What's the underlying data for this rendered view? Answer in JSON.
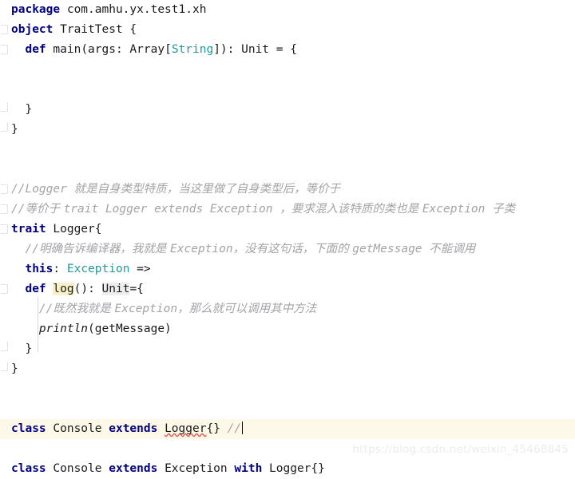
{
  "app": {
    "kind": "code-editor",
    "language": "Scala",
    "background": "#ffffff",
    "current_line_background": "#fdf8e8",
    "colors": {
      "keyword": "#000080",
      "type": "#20999d",
      "comment": "#a3a3a8",
      "identifier_highlight": "#faf0c8",
      "soft_highlight": "#eeeeee",
      "error_squiggle": "#e05a4f",
      "text": "#1a1a1a"
    }
  },
  "watermark": {
    "text": "https://blog.csdn.net/weixin_45468845"
  },
  "code": {
    "lines": [
      {
        "id": 1,
        "fold": "none",
        "tokens": [
          {
            "t": "package",
            "c": "kw"
          },
          {
            "t": " com.amhu.yx.test1.xh",
            "c": "plain"
          }
        ]
      },
      {
        "id": 2,
        "fold": "start",
        "tokens": [
          {
            "t": "object",
            "c": "kw"
          },
          {
            "t": " TraitTest {",
            "c": "plain"
          }
        ]
      },
      {
        "id": 3,
        "fold": "start",
        "indent": 1,
        "tokens": [
          {
            "t": "  ",
            "c": "plain"
          },
          {
            "t": "def",
            "c": "kw"
          },
          {
            "t": " main(args: Array[",
            "c": "plain"
          },
          {
            "t": "String",
            "c": "type"
          },
          {
            "t": "]): Unit = {",
            "c": "plain"
          }
        ]
      },
      {
        "id": 4,
        "fold": "none",
        "tokens": []
      },
      {
        "id": 5,
        "fold": "none",
        "tokens": []
      },
      {
        "id": 6,
        "fold": "end",
        "tokens": [
          {
            "t": "  }",
            "c": "plain"
          }
        ]
      },
      {
        "id": 7,
        "fold": "end",
        "tokens": [
          {
            "t": "}",
            "c": "plain"
          }
        ]
      },
      {
        "id": 8,
        "fold": "none",
        "tokens": []
      },
      {
        "id": 9,
        "fold": "none",
        "tokens": []
      },
      {
        "id": 10,
        "fold": "start",
        "tokens": [
          {
            "t": "//Logger ",
            "c": "cmt-mono"
          },
          {
            "t": "就是自身类型特质，当这里做了自身类型后，等价于",
            "c": "cmt"
          }
        ]
      },
      {
        "id": 11,
        "fold": "start",
        "tokens": [
          {
            "t": "//",
            "c": "cmt-mono"
          },
          {
            "t": "等价于 ",
            "c": "cmt"
          },
          {
            "t": "trait Logger extends Exception ",
            "c": "cmt-mono"
          },
          {
            "t": "，要求混入该特质的类也是 ",
            "c": "cmt"
          },
          {
            "t": "Exception ",
            "c": "cmt-mono"
          },
          {
            "t": "子类",
            "c": "cmt"
          }
        ]
      },
      {
        "id": 12,
        "fold": "start",
        "tokens": [
          {
            "t": "trait",
            "c": "kw"
          },
          {
            "t": " Logger{",
            "c": "plain"
          }
        ]
      },
      {
        "id": 13,
        "fold": "none",
        "tokens": [
          {
            "t": "  ",
            "c": "plain"
          },
          {
            "t": "//",
            "c": "cmt-mono"
          },
          {
            "t": "明确告诉编译器，我就是 ",
            "c": "cmt"
          },
          {
            "t": "Exception",
            "c": "cmt-mono"
          },
          {
            "t": "，没有这句话，下面的 ",
            "c": "cmt"
          },
          {
            "t": "getMessage ",
            "c": "cmt-mono"
          },
          {
            "t": "不能调用",
            "c": "cmt"
          }
        ]
      },
      {
        "id": 14,
        "fold": "none",
        "tokens": [
          {
            "t": "  ",
            "c": "plain"
          },
          {
            "t": "this",
            "c": "kw"
          },
          {
            "t": ": ",
            "c": "plain"
          },
          {
            "t": "Exception",
            "c": "type"
          },
          {
            "t": " =>",
            "c": "plain"
          }
        ]
      },
      {
        "id": 15,
        "fold": "start",
        "indent": 1,
        "tokens": [
          {
            "t": "  ",
            "c": "plain"
          },
          {
            "t": "def",
            "c": "kw"
          },
          {
            "t": " ",
            "c": "plain"
          },
          {
            "t": "log",
            "c": "hl-ident"
          },
          {
            "t": "(): ",
            "c": "plain"
          },
          {
            "t": "Unit",
            "c": "hl-soft"
          },
          {
            "t": "={",
            "c": "plain"
          }
        ]
      },
      {
        "id": 16,
        "fold": "none",
        "tokens": [
          {
            "t": "    ",
            "c": "plain"
          },
          {
            "t": "//",
            "c": "cmt-mono"
          },
          {
            "t": "既然我就是 ",
            "c": "cmt"
          },
          {
            "t": "Exception",
            "c": "cmt-mono"
          },
          {
            "t": "，那么就可以调用其中方法",
            "c": "cmt"
          }
        ]
      },
      {
        "id": 17,
        "fold": "none",
        "tokens": [
          {
            "t": "    ",
            "c": "plain"
          },
          {
            "t": "println",
            "c": "fn"
          },
          {
            "t": "(getMessage)",
            "c": "plain"
          }
        ]
      },
      {
        "id": 18,
        "fold": "end",
        "tokens": [
          {
            "t": "  }",
            "c": "plain"
          }
        ]
      },
      {
        "id": 19,
        "fold": "end",
        "tokens": [
          {
            "t": "}",
            "c": "plain"
          }
        ]
      },
      {
        "id": 20,
        "fold": "none",
        "tokens": []
      },
      {
        "id": 21,
        "fold": "none",
        "tokens": []
      },
      {
        "id": 22,
        "fold": "none",
        "current": true,
        "tokens": [
          {
            "t": "class",
            "c": "kw"
          },
          {
            "t": " Console ",
            "c": "plain"
          },
          {
            "t": "extends",
            "c": "kw"
          },
          {
            "t": " ",
            "c": "plain"
          },
          {
            "t": "Logger",
            "c": "err"
          },
          {
            "t": "{} ",
            "c": "plain"
          },
          {
            "t": "//",
            "c": "slash"
          },
          {
            "t": "",
            "c": "caret"
          }
        ]
      },
      {
        "id": 23,
        "fold": "none",
        "tokens": []
      },
      {
        "id": 24,
        "fold": "none",
        "tokens": [
          {
            "t": "class",
            "c": "kw"
          },
          {
            "t": " Console ",
            "c": "plain"
          },
          {
            "t": "extends",
            "c": "kw"
          },
          {
            "t": " Exception ",
            "c": "plain"
          },
          {
            "t": "with",
            "c": "kw"
          },
          {
            "t": " Logger{}",
            "c": "plain"
          }
        ]
      }
    ]
  }
}
